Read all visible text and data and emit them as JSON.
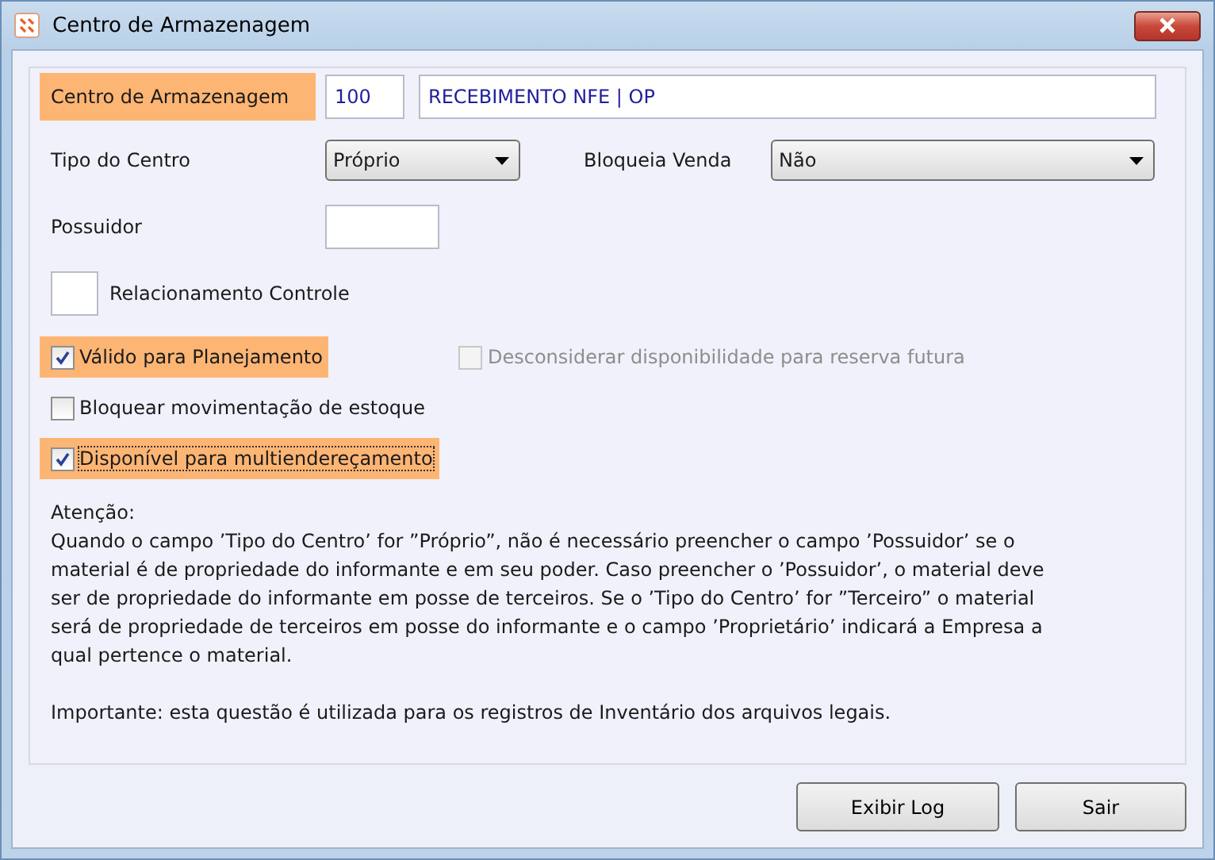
{
  "window": {
    "title": "Centro de Armazenagem"
  },
  "centro": {
    "label": "Centro de Armazenagem",
    "highlighted": true,
    "code": "100",
    "description": "RECEBIMENTO NFE | OP"
  },
  "tipo_do_centro": {
    "label": "Tipo do Centro",
    "value": "Próprio"
  },
  "bloqueia_venda": {
    "label": "Bloqueia Venda",
    "value": "Não"
  },
  "possuidor": {
    "label": "Possuidor"
  },
  "relacionamento_controle": {
    "label": "Relacionamento Controle"
  },
  "options": [
    {
      "label": "Válido para Planejamento",
      "checked": true,
      "disabled": false,
      "highlighted": true,
      "focused": false
    },
    {
      "label": "Desconsiderar disponibilidade para reserva futura",
      "checked": false,
      "disabled": true,
      "highlighted": false,
      "focused": false
    },
    {
      "label": "Bloquear movimentação de estoque",
      "checked": false,
      "disabled": false,
      "highlighted": false,
      "focused": false
    },
    {
      "label": "Disponível para multiendereçamento",
      "checked": true,
      "disabled": false,
      "highlighted": true,
      "focused": true
    }
  ],
  "notice": {
    "heading": "Atenção:",
    "text": "Quando o campo ’Tipo do Centro’ for ”Próprio”, não é necessário preencher o campo ’Possuidor’ se o material é de propriedade do informante e em seu poder. Caso preencher o ’Possuidor’, o material deve ser de propriedade do informante em posse de terceiros. Se o ’Tipo do Centro’ for ”Terceiro” o material será de propriedade de terceiros em posse do informante e o campo ’Proprietário’ indicará a Empresa a qual pertence o material.",
    "important": "Importante: esta questão é utilizada para os registros de Inventário dos arquivos legais."
  },
  "buttons": [
    "Exibir Log",
    "Sair"
  ]
}
